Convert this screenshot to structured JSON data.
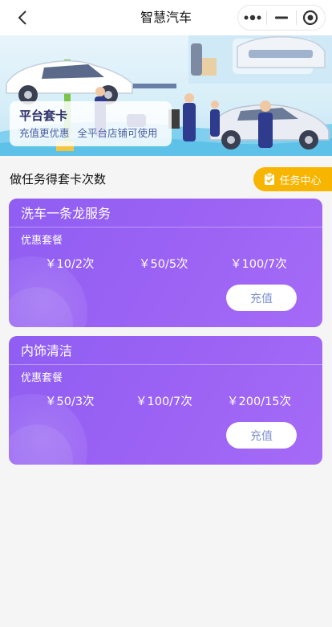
{
  "nav": {
    "title": "智慧汽车"
  },
  "banner": {
    "title": "平台套卡",
    "subtitle_1": "充值更优惠",
    "subtitle_2": "全平台店铺可使用"
  },
  "section": {
    "title": "做任务得套卡次数",
    "task_button": "任务中心"
  },
  "packages": [
    {
      "name": "洗车一条龙服务",
      "label": "优惠套餐",
      "options": [
        "￥10/2次",
        "￥50/5次",
        "￥100/7次"
      ],
      "button": "充值"
    },
    {
      "name": "内饰清洁",
      "label": "优惠套餐",
      "options": [
        "￥50/3次",
        "￥100/7次",
        "￥200/15次"
      ],
      "button": "充值"
    }
  ],
  "colors": {
    "accent": "#9b62f4",
    "task_button": "#f7b500",
    "page_bg": "#f5f5f5"
  }
}
